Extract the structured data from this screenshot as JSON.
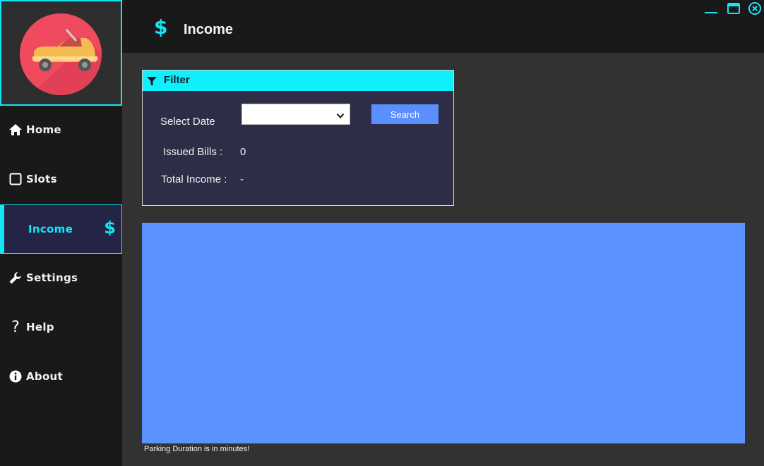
{
  "header": {
    "title": "Income",
    "icon": "dollar-icon"
  },
  "sidebar": {
    "items": [
      {
        "label": "Home",
        "icon": "home-icon"
      },
      {
        "label": "Slots",
        "icon": "square-icon"
      },
      {
        "label": "Income",
        "icon": "dollar-icon",
        "active": true
      },
      {
        "label": "Settings",
        "icon": "wrench-icon"
      },
      {
        "label": "Help",
        "icon": "question-icon"
      },
      {
        "label": "About",
        "icon": "info-icon"
      }
    ]
  },
  "filter": {
    "title": "Filter",
    "select_date_label": "Select Date",
    "selected_date": "",
    "search_label": "Search",
    "issued_bills_label": "Issued Bills :",
    "issued_bills_value": "0",
    "total_income_label": "Total Income :",
    "total_income_value": "-"
  },
  "footer_note": "Parking Duration is in minutes!",
  "colors": {
    "accent": "#12e6f5",
    "chart_bg": "#5b92fd",
    "search_btn": "#5b8ffd",
    "sidebar_bg": "#191919",
    "main_bg": "#323232",
    "panel_bg": "#2d2d47"
  }
}
